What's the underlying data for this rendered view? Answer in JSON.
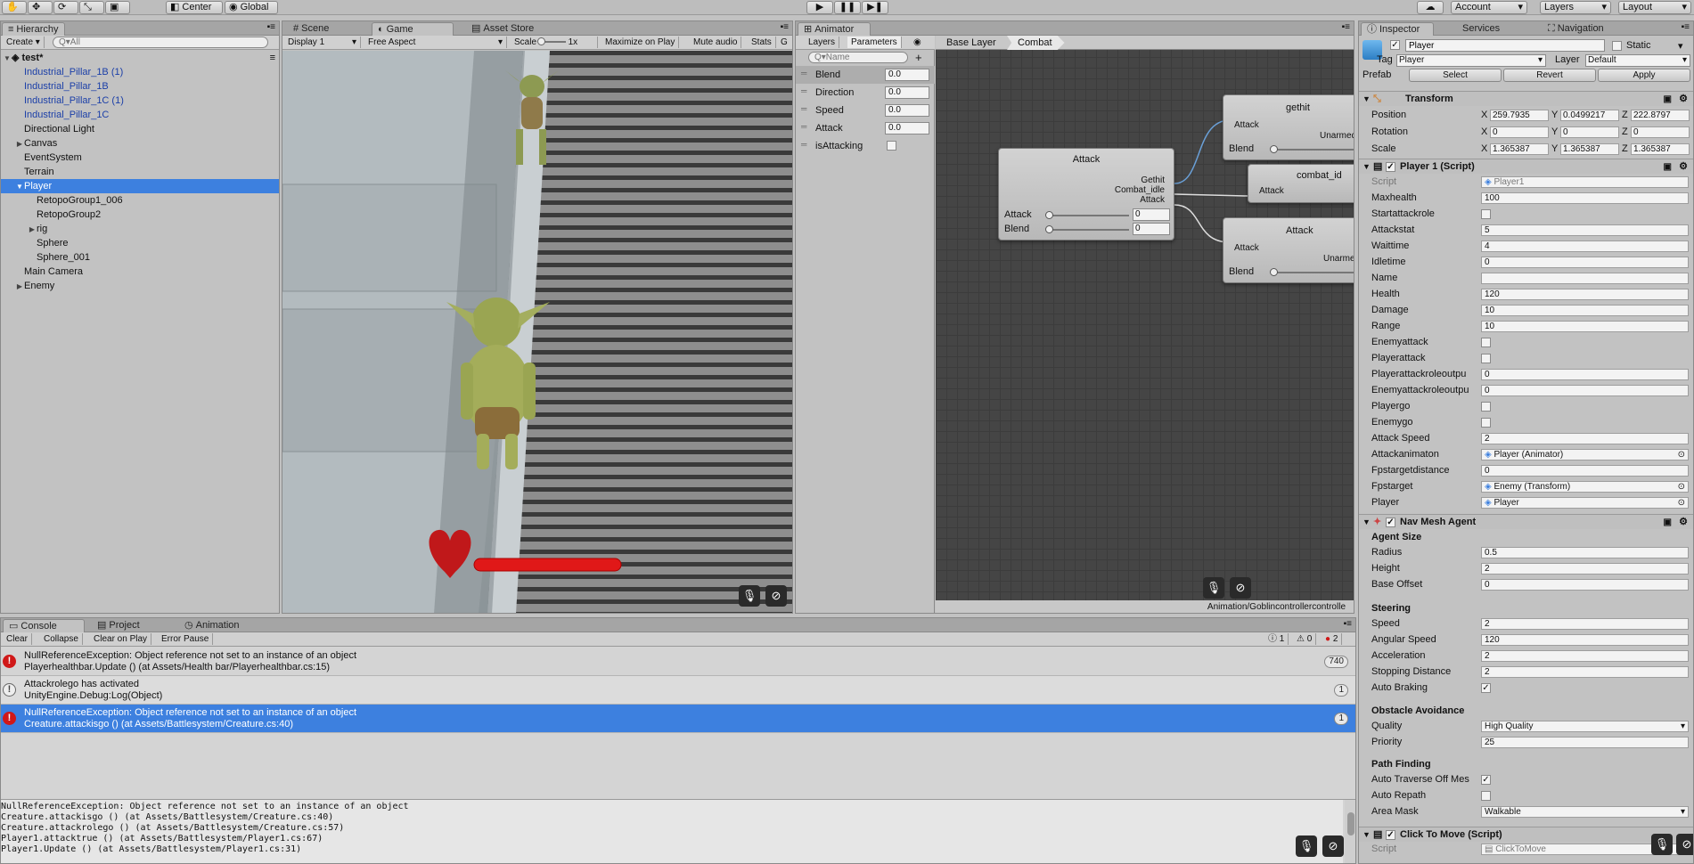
{
  "toolbar": {
    "center": "Center",
    "global": "Global",
    "account": "Account",
    "layers": "Layers",
    "layout": "Layout"
  },
  "hierarchy": {
    "tab": "Hierarchy",
    "create": "Create",
    "search_placeholder": "Q▾All",
    "scene": "test*",
    "items": [
      {
        "label": "Industrial_Pillar_1B (1)",
        "indent": 1,
        "prefab": true,
        "arrow": false,
        "selected": false
      },
      {
        "label": "Industrial_Pillar_1B",
        "indent": 1,
        "prefab": true,
        "arrow": false,
        "selected": false
      },
      {
        "label": "Industrial_Pillar_1C (1)",
        "indent": 1,
        "prefab": true,
        "arrow": false,
        "selected": false
      },
      {
        "label": "Industrial_Pillar_1C",
        "indent": 1,
        "prefab": true,
        "arrow": false,
        "selected": false
      },
      {
        "label": "Directional Light",
        "indent": 1,
        "prefab": false,
        "arrow": false,
        "selected": false
      },
      {
        "label": "Canvas",
        "indent": 1,
        "prefab": false,
        "arrow": "right",
        "selected": false
      },
      {
        "label": "EventSystem",
        "indent": 1,
        "prefab": false,
        "arrow": false,
        "selected": false
      },
      {
        "label": "Terrain",
        "indent": 1,
        "prefab": false,
        "arrow": false,
        "selected": false
      },
      {
        "label": "Player",
        "indent": 1,
        "prefab": false,
        "arrow": "down",
        "selected": true
      },
      {
        "label": "RetopoGroup1_006",
        "indent": 2,
        "prefab": false,
        "arrow": false,
        "selected": false
      },
      {
        "label": "RetopoGroup2",
        "indent": 2,
        "prefab": false,
        "arrow": false,
        "selected": false
      },
      {
        "label": "rig",
        "indent": 2,
        "prefab": false,
        "arrow": "right",
        "selected": false
      },
      {
        "label": "Sphere",
        "indent": 2,
        "prefab": false,
        "arrow": false,
        "selected": false
      },
      {
        "label": "Sphere_001",
        "indent": 2,
        "prefab": false,
        "arrow": false,
        "selected": false
      },
      {
        "label": "Main Camera",
        "indent": 1,
        "prefab": false,
        "arrow": false,
        "selected": false
      },
      {
        "label": "Enemy",
        "indent": 1,
        "prefab": false,
        "arrow": "right",
        "selected": false
      }
    ]
  },
  "scene_tabs": {
    "scene": "Scene",
    "game": "Game",
    "asset_store": "Asset Store"
  },
  "game_bar": {
    "display": "Display 1",
    "aspect": "Free Aspect",
    "scale_label": "Scale",
    "scale_value": "1x",
    "maximize": "Maximize on Play",
    "mute": "Mute audio",
    "stats": "Stats"
  },
  "animator": {
    "tab": "Animator",
    "layers": "Layers",
    "parameters": "Parameters",
    "search_placeholder": "Q▾Name",
    "breadcrumb_base": "Base Layer",
    "breadcrumb_sub": "Combat",
    "params": [
      {
        "name": "Blend",
        "value": "0.0",
        "type": "float"
      },
      {
        "name": "Direction",
        "value": "0.0",
        "type": "float"
      },
      {
        "name": "Speed",
        "value": "0.0",
        "type": "float"
      },
      {
        "name": "Attack",
        "value": "0.0",
        "type": "float"
      },
      {
        "name": "isAttacking",
        "value": "",
        "type": "bool"
      }
    ],
    "node_attack": {
      "title": "Attack",
      "out1": "Gethit",
      "out2": "Combat_idle",
      "out3": "Attack",
      "in1": "Attack",
      "in1v": "0",
      "in2": "Blend",
      "in2v": "0"
    },
    "node_gethit": {
      "title": "gethit",
      "in": "Attack",
      "out": "Unarmed-",
      "blend": "Blend"
    },
    "node_combat": {
      "title": "combat_id",
      "in": "Attack"
    },
    "node_attack2": {
      "title": "Attack",
      "in": "Attack",
      "out": "Unarmed",
      "blend": "Blend"
    },
    "path": "Animation/Goblincontrollercontrolle"
  },
  "console": {
    "tabs": [
      "Console",
      "Project",
      "Animation"
    ],
    "buttons": [
      "Clear",
      "Collapse",
      "Clear on Play",
      "Error Pause"
    ],
    "count_info": "1",
    "count_warn": "0",
    "count_err": "2",
    "rows": [
      {
        "type": "error",
        "line1": "NullReferenceException: Object reference not set to an instance of an object",
        "line2": "Playerhealthbar.Update () (at Assets/Health bar/Playerhealthbar.cs:15)",
        "count": "740",
        "selected": false
      },
      {
        "type": "info",
        "line1": "Attackrolego has activated",
        "line2": "UnityEngine.Debug:Log(Object)",
        "count": "1",
        "selected": false
      },
      {
        "type": "error",
        "line1": "NullReferenceException: Object reference not set to an instance of an object",
        "line2": "Creature.attackisgo () (at Assets/Battlesystem/Creature.cs:40)",
        "count": "1",
        "selected": true
      }
    ],
    "detail": [
      "NullReferenceException: Object reference not set to an instance of an object",
      "Creature.attackisgo () (at Assets/Battlesystem/Creature.cs:40)",
      "Creature.attackrolego () (at Assets/Battlesystem/Creature.cs:57)",
      "Player1.attacktrue () (at Assets/Battlesystem/Player1.cs:67)",
      "Player1.Update () (at Assets/Battlesystem/Player1.cs:31)"
    ]
  },
  "inspector": {
    "tabs": [
      "Inspector",
      "Services",
      "Navigation"
    ],
    "name": "Player",
    "static": "Static",
    "tag_label": "Tag",
    "tag": "Player",
    "layer_label": "Layer",
    "layer": "Default",
    "prefab": "Prefab",
    "select": "Select",
    "revert": "Revert",
    "apply": "Apply",
    "transform": {
      "title": "Transform",
      "rows": [
        {
          "label": "Position",
          "x": "259.7935",
          "y": "0.0499217",
          "z": "222.8797"
        },
        {
          "label": "Rotation",
          "x": "0",
          "y": "0",
          "z": "0"
        },
        {
          "label": "Scale",
          "x": "1.365387",
          "y": "1.365387",
          "z": "1.365387"
        }
      ]
    },
    "player_script": {
      "title": "Player 1 (Script)",
      "rows": [
        {
          "label": "Script",
          "value": "Player1",
          "kind": "obj"
        },
        {
          "label": "Maxhealth",
          "value": "100",
          "kind": "text"
        },
        {
          "label": "Startattackrole",
          "value": "",
          "kind": "check"
        },
        {
          "label": "Attackstat",
          "value": "5",
          "kind": "text"
        },
        {
          "label": "Waittime",
          "value": "4",
          "kind": "text"
        },
        {
          "label": "Idletime",
          "value": "0",
          "kind": "text"
        },
        {
          "label": "Name",
          "value": "",
          "kind": "text"
        },
        {
          "label": "Health",
          "value": "120",
          "kind": "text"
        },
        {
          "label": "Damage",
          "value": "10",
          "kind": "text"
        },
        {
          "label": "Range",
          "value": "10",
          "kind": "text"
        },
        {
          "label": "Enemyattack",
          "value": "",
          "kind": "check"
        },
        {
          "label": "Playerattack",
          "value": "",
          "kind": "check"
        },
        {
          "label": "Playerattackroleoutpu",
          "value": "0",
          "kind": "text"
        },
        {
          "label": "Enemyattackroleoutpu",
          "value": "0",
          "kind": "text"
        },
        {
          "label": "Playergo",
          "value": "",
          "kind": "check"
        },
        {
          "label": "Enemygo",
          "value": "",
          "kind": "check"
        },
        {
          "label": "Attack Speed",
          "value": "2",
          "kind": "text"
        },
        {
          "label": "Attackanimaton",
          "value": "Player (Animator)",
          "kind": "obj"
        },
        {
          "label": "Fpstargetdistance",
          "value": "0",
          "kind": "text"
        },
        {
          "label": "Fpstarget",
          "value": "Enemy (Transform)",
          "kind": "obj"
        },
        {
          "label": "Player",
          "value": "Player",
          "kind": "obj"
        }
      ]
    },
    "navmesh": {
      "title": "Nav Mesh Agent",
      "agent_size": "Agent Size",
      "steering": "Steering",
      "obstacle": "Obstacle Avoidance",
      "pathfinding": "Path Finding",
      "size_rows": [
        {
          "label": "Radius",
          "value": "0.5"
        },
        {
          "label": "Height",
          "value": "2"
        },
        {
          "label": "Base Offset",
          "value": "0"
        }
      ],
      "steer_rows": [
        {
          "label": "Speed",
          "value": "2",
          "kind": "text"
        },
        {
          "label": "Angular Speed",
          "value": "120",
          "kind": "text"
        },
        {
          "label": "Acceleration",
          "value": "2",
          "kind": "text"
        },
        {
          "label": "Stopping Distance",
          "value": "2",
          "kind": "text"
        },
        {
          "label": "Auto Braking",
          "value": "✓",
          "kind": "check"
        }
      ],
      "obst_rows": [
        {
          "label": "Quality",
          "value": "High Quality",
          "kind": "drop"
        },
        {
          "label": "Priority",
          "value": "25",
          "kind": "text"
        }
      ],
      "path_rows": [
        {
          "label": "Auto Traverse Off Mes",
          "value": "✓",
          "kind": "check"
        },
        {
          "label": "Auto Repath",
          "value": "",
          "kind": "check"
        },
        {
          "label": "Area Mask",
          "value": "Walkable",
          "kind": "drop"
        }
      ]
    },
    "click_script": {
      "title": "Click To Move (Script)",
      "script_label": "Script",
      "script_value": "ClickToMove"
    }
  },
  "colors": {
    "selection": "#3d80df",
    "health": "#e01818",
    "error": "#d01818"
  }
}
